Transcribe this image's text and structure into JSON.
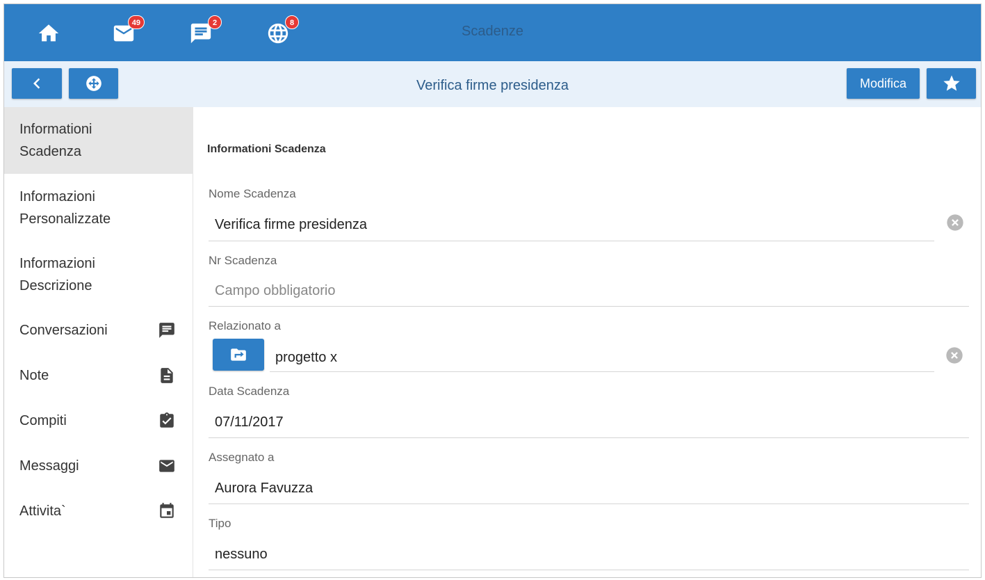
{
  "topbar": {
    "title": "Scadenze",
    "home_icon": "home-icon",
    "mail": {
      "icon": "mail-icon",
      "badge": "49"
    },
    "chat": {
      "icon": "chat-icon",
      "badge": "2"
    },
    "web": {
      "icon": "globe-icon",
      "badge": "8"
    }
  },
  "subbar": {
    "title": "Verifica firme presidenza",
    "edit_label": "Modifica",
    "back_icon": "chevron-left-icon",
    "move_icon": "move-icon",
    "star_icon": "star-icon"
  },
  "sidebar": {
    "items": [
      {
        "line1": "Informationi",
        "line2": "Scadenza",
        "active": true
      },
      {
        "line1": "Informazioni",
        "line2": "Personalizzate"
      },
      {
        "line1": "Informazioni",
        "line2": "Descrizione"
      },
      {
        "label": "Conversazioni",
        "icon": "chat-icon"
      },
      {
        "label": "Note",
        "icon": "document-icon"
      },
      {
        "label": "Compiti",
        "icon": "clipboard-check-icon"
      },
      {
        "label": "Messaggi",
        "icon": "mail-icon"
      },
      {
        "label": "Attivita`",
        "icon": "calendar-icon"
      }
    ]
  },
  "main": {
    "section_title": "Informationi Scadenza",
    "fields": {
      "nome": {
        "label": "Nome Scadenza",
        "value": "Verifica firme presidenza"
      },
      "nr": {
        "label": "Nr Scadenza",
        "placeholder": "Campo obbligatorio"
      },
      "relazionato": {
        "label": "Relazionato a",
        "value": "progetto x"
      },
      "data": {
        "label": "Data Scadenza",
        "value": "07/11/2017"
      },
      "assegnato": {
        "label": "Assegnato a",
        "value": "Aurora Favuzza"
      },
      "tipo": {
        "label": "Tipo",
        "value": "nessuno"
      }
    }
  },
  "colors": {
    "primary": "#2f7fc6",
    "subbar_bg": "#e8f1fa",
    "badge": "#e53935",
    "active_item": "#e6e6e6"
  }
}
